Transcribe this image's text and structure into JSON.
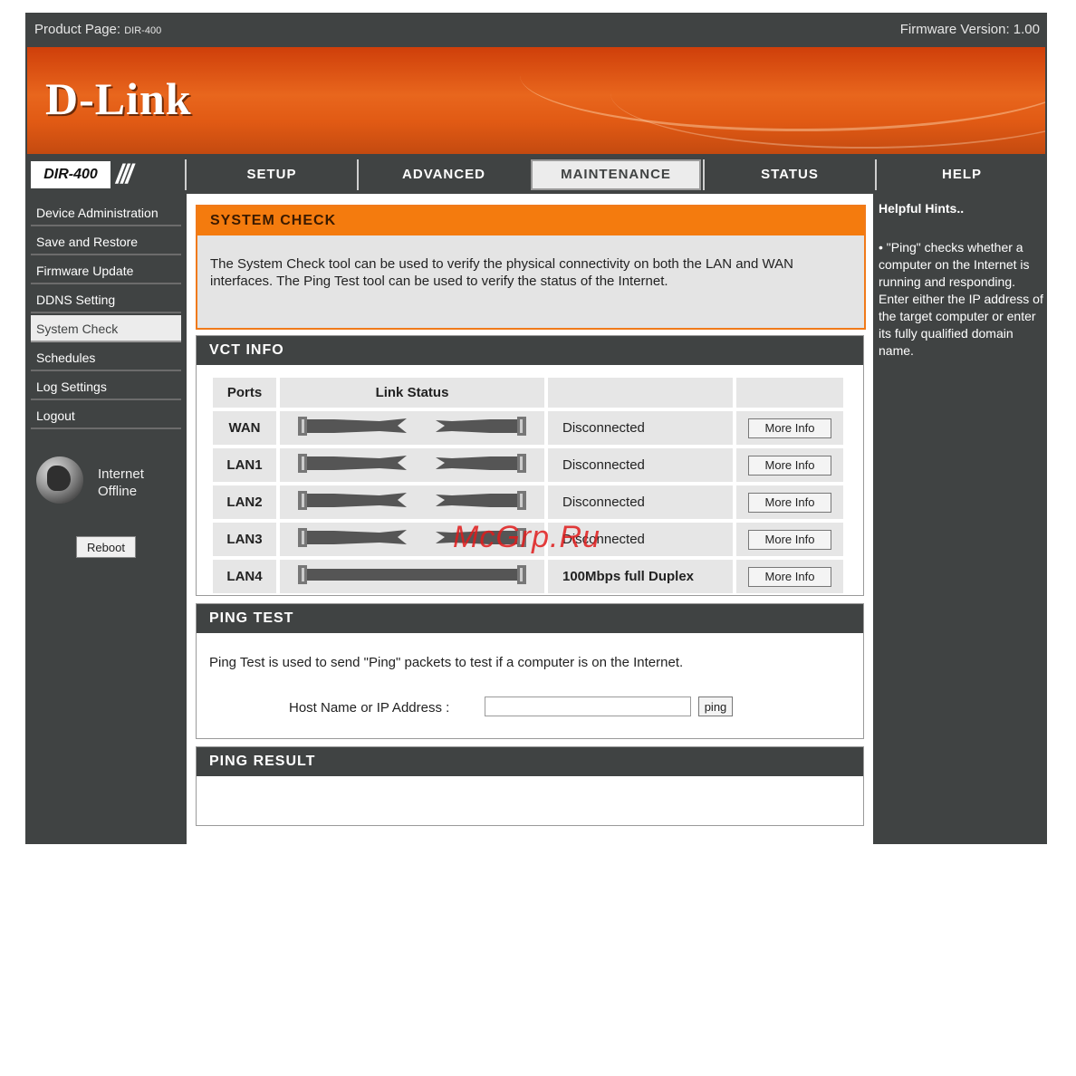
{
  "topbar": {
    "product_label": "Product Page:",
    "product_model": "DIR-400",
    "firmware": "Firmware Version: 1.00"
  },
  "brand": {
    "logo": "D-Link",
    "model": "DIR-400"
  },
  "nav": {
    "tabs": [
      "SETUP",
      "ADVANCED",
      "MAINTENANCE",
      "STATUS",
      "HELP"
    ],
    "active": "MAINTENANCE"
  },
  "sidebar": {
    "items": [
      "Device Administration",
      "Save and Restore",
      "Firmware Update",
      "DDNS Setting",
      "System Check",
      "Schedules",
      "Log Settings",
      "Logout"
    ],
    "active": "System Check",
    "internet_status": "Internet\nOffline",
    "reboot_label": "Reboot"
  },
  "system_check": {
    "title": "SYSTEM CHECK",
    "description": "The System Check tool can be used to verify the physical connectivity on both the LAN and WAN interfaces. The Ping Test tool can be used to verify the status of the Internet."
  },
  "vct": {
    "title": "VCT INFO",
    "headers": {
      "ports": "Ports",
      "link_status": "Link Status"
    },
    "rows": [
      {
        "port": "WAN",
        "status": "Disconnected",
        "connected": false
      },
      {
        "port": "LAN1",
        "status": "Disconnected",
        "connected": false
      },
      {
        "port": "LAN2",
        "status": "Disconnected",
        "connected": false
      },
      {
        "port": "LAN3",
        "status": "Disconnected",
        "connected": false
      },
      {
        "port": "LAN4",
        "status": "100Mbps full Duplex",
        "connected": true
      }
    ],
    "more_info_label": "More Info"
  },
  "ping_test": {
    "title": "PING TEST",
    "description": "Ping Test is used to send \"Ping\" packets to test if a computer is on the Internet.",
    "host_label": "Host Name or IP Address :",
    "host_value": "",
    "ping_button": "ping"
  },
  "ping_result": {
    "title": "PING RESULT"
  },
  "help": {
    "title": "Helpful Hints..",
    "text": "• \"Ping\" checks whether a computer on the Internet is running and responding. Enter either the IP address of the target computer or enter its fully qualified domain name."
  },
  "watermark": "McGrp.Ru",
  "colors": {
    "accent": "#f47b0e",
    "dark": "#404343",
    "panel": "#e6e6e6"
  }
}
